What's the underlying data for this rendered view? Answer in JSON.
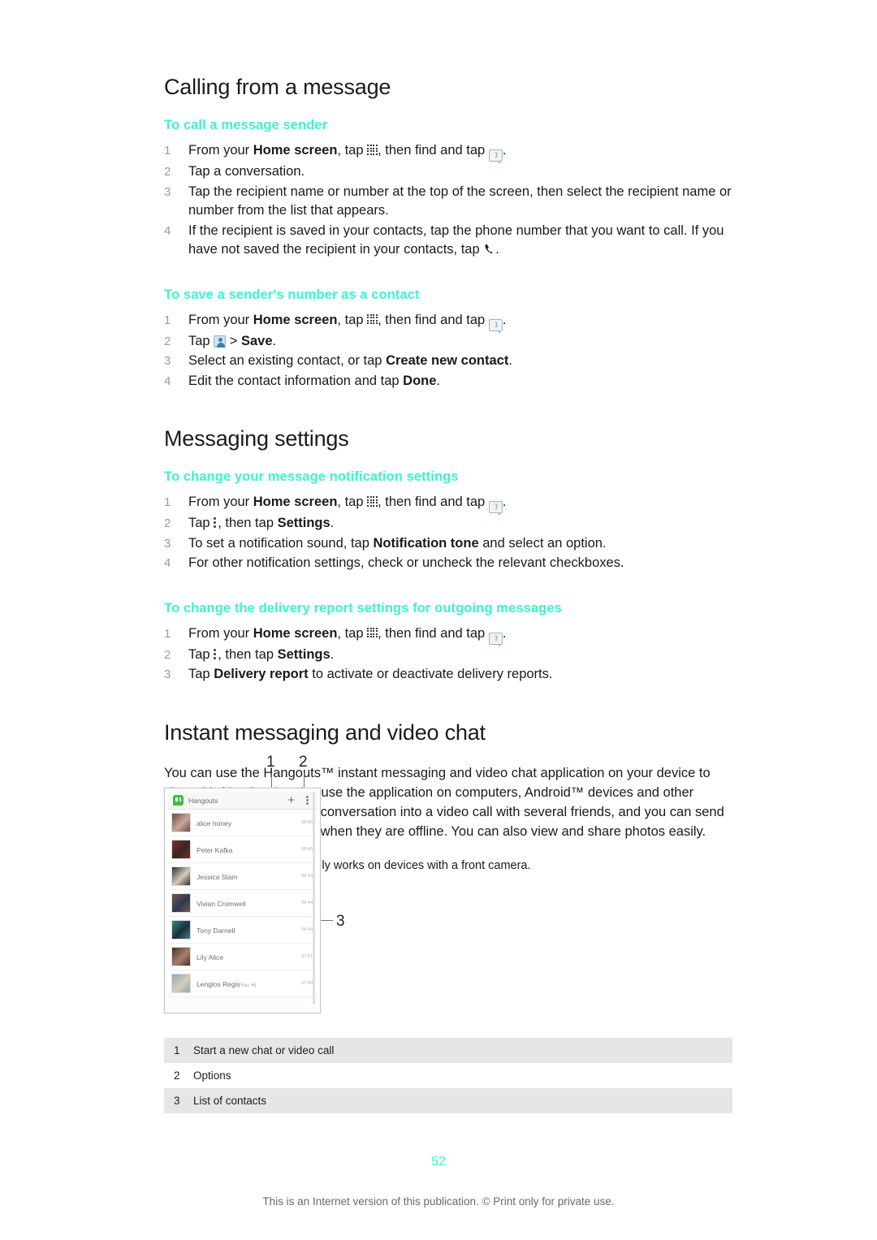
{
  "sections": [
    {
      "heading": "Calling from a message",
      "subsections": [
        {
          "title": "To call a message sender",
          "steps": [
            {
              "num": "1",
              "html": "From your <b>Home screen</b>, tap <ICON:apps>, then find and tap <ICON:msg>."
            },
            {
              "num": "2",
              "html": "Tap a conversation."
            },
            {
              "num": "3",
              "html": "Tap the recipient name or number at the top of the screen, then select the recipient name or number from the list that appears."
            },
            {
              "num": "4",
              "html": "If the recipient is saved in your contacts, tap the phone number that you want to call. If you have not saved the recipient in your contacts, tap <ICON:phone>."
            }
          ]
        },
        {
          "title": "To save a sender's number as a contact",
          "steps": [
            {
              "num": "1",
              "html": "From your <b>Home screen</b>, tap <ICON:apps>, then find and tap <ICON:msg>."
            },
            {
              "num": "2",
              "html": "Tap <ICON:contact> > <b>Save</b>."
            },
            {
              "num": "3",
              "html": "Select an existing contact, or tap <b>Create new contact</b>."
            },
            {
              "num": "4",
              "html": "Edit the contact information and tap <b>Done</b>."
            }
          ]
        }
      ]
    },
    {
      "heading": "Messaging settings",
      "subsections": [
        {
          "title": "To change your message notification settings",
          "steps": [
            {
              "num": "1",
              "html": "From your <b>Home screen</b>, tap <ICON:apps>, then find and tap <ICON:msg>."
            },
            {
              "num": "2",
              "html": "Tap <ICON:dots>, then tap <b>Settings</b>."
            },
            {
              "num": "3",
              "html": "To set a notification sound, tap <b>Notification tone</b> and select an option."
            },
            {
              "num": "4",
              "html": "For other notification settings, check or uncheck the relevant checkboxes."
            }
          ]
        },
        {
          "title": "To change the delivery report settings for outgoing messages",
          "steps": [
            {
              "num": "1",
              "html": "From your <b>Home screen</b>, tap <ICON:apps>, then find and tap <ICON:msg>."
            },
            {
              "num": "2",
              "html": "Tap <ICON:dots>, then tap <b>Settings</b>."
            },
            {
              "num": "3",
              "html": "Tap <b>Delivery report</b> to activate or deactivate delivery reports."
            }
          ]
        }
      ]
    }
  ],
  "instant_messaging": {
    "heading": "Instant messaging and video chat",
    "paragraph": "You can use the Hangouts™ instant messaging and video chat application on your device to chat with friends who also use the application on computers, Android™ devices and other devices. You can turn any conversation into a video call with several friends, and you can send messages to friends even when they are offline. You can also view and share photos easily.",
    "note_icon": "!",
    "note": "The video call function only works on devices with a front camera."
  },
  "figure": {
    "callouts": [
      {
        "label": "1",
        "target": "new-chat-button"
      },
      {
        "label": "2",
        "target": "options-button"
      },
      {
        "label": "3",
        "target": "contacts-list"
      }
    ],
    "app": {
      "title": "Hangouts",
      "logo_icon": "hangouts-logo-icon",
      "add_icon": "+",
      "options_icon": "overflow-menu-icon",
      "contacts": [
        {
          "name": "alice honey",
          "time": "08:45",
          "sub": "",
          "c1": "#6b4a42",
          "c2": "#caa79a"
        },
        {
          "name": "Peter Kafka",
          "time": "08:45",
          "sub": "",
          "c1": "#7a2f28",
          "c2": "#3a2520"
        },
        {
          "name": "Jessica Stam",
          "time": "08:44",
          "sub": "",
          "c1": "#2b3038",
          "c2": "#d8c9b6"
        },
        {
          "name": "Vivian Cromwell",
          "time": "08:44",
          "sub": "",
          "c1": "#7e5246",
          "c2": "#2c3a55"
        },
        {
          "name": "Tony Darnell",
          "time": "08:44",
          "sub": "",
          "c1": "#3f7f86",
          "c2": "#1d3038"
        },
        {
          "name": "Lily Alice",
          "time": "07:51",
          "sub": "",
          "c1": "#4b2f2b",
          "c2": "#a87f6c"
        },
        {
          "name": "Lenglos Regis",
          "time": "07:49",
          "sub": "You: Hi",
          "c1": "#8fa9bc",
          "c2": "#d6cdb8"
        }
      ]
    }
  },
  "legend": {
    "rows": [
      {
        "num": "1",
        "text": "Start a new chat or video call"
      },
      {
        "num": "2",
        "text": "Options"
      },
      {
        "num": "3",
        "text": "List of contacts"
      }
    ]
  },
  "page_number": "52",
  "footer": "This is an Internet version of this publication. © Print only for private use.",
  "colors": {
    "accent": "#3df3d2",
    "legend_alt_bg": "#e6e6e6",
    "hangouts_green": "#3ec03e"
  }
}
